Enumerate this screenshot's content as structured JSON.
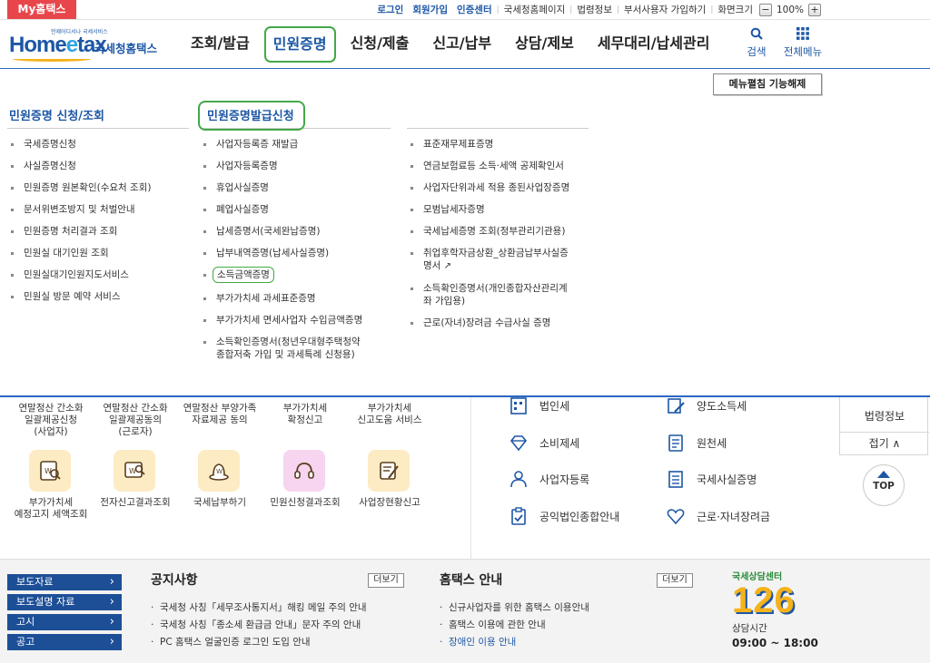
{
  "utility": {
    "my_tab": "My홈택스",
    "links": [
      "로그인",
      "회원가입",
      "인증센터",
      "국세청홈페이지",
      "법령정보",
      "부서사용자 가입하기",
      "화면크기"
    ],
    "zoom": "100%",
    "zoom_minus": "−",
    "zoom_plus": "+"
  },
  "header": {
    "logo_small": "언제어디서나 국세서비스",
    "logo_home": "Home",
    "logo_e": "e",
    "logo_tax": "tax",
    "logo_name": "국세청홈택스",
    "gnb": [
      "조회/발급",
      "민원증명",
      "신청/제출",
      "신고/납부",
      "상담/제보",
      "세무대리/납세관리"
    ],
    "search": "검색",
    "all_menu": "전체메뉴"
  },
  "mega": {
    "menu_off_button": "메뉴펼침 기능해제",
    "col1": {
      "heading": "민원증명 신청/조회",
      "items": [
        "국세증명신청",
        "사실증명신청",
        "민원증명 원본확인(수요처 조회)",
        "문서위변조방지 및 처벌안내",
        "민원증명 처리결과 조회",
        "민원실 대기인원 조회",
        "민원실대기인원지도서비스",
        "민원실 방문 예약 서비스"
      ]
    },
    "col2": {
      "heading": "민원증명발급신청",
      "items": [
        "사업자등록증 재발급",
        "사업자등록증명",
        "휴업사실증명",
        "폐업사실증명",
        "납세증명서(국세완납증명)",
        "납부내역증명(납세사실증명)",
        "소득금액증명",
        "부가가치세 과세표준증명",
        "부가가치세 면세사업자 수입금액증명"
      ],
      "item_last_line1": "소득확인증명서(청년우대형주택청약",
      "item_last_line2": "종합저축 가입 및 과세특례 신청용)"
    },
    "col3": {
      "items": [
        "표준재무제표증명",
        "연금보험료등 소득·세액 공제확인서",
        "사업자단위과세 적용 종된사업장증명",
        "모범납세자증명",
        "국세납세증명 조회(정부관리기관용)"
      ],
      "item6_line1": "취업후학자금상환_상환금납부사실증",
      "item6_line2": "명서",
      "item7_line1": "소득확인증명서(개인종합자산관리계",
      "item7_line2": "좌 가입용)",
      "item8": "근로(자녀)장려금 수급사실 증명"
    }
  },
  "main": {
    "quick_row1": [
      [
        "연말정산 간소화",
        "일괄제공신청",
        "(사업자)"
      ],
      [
        "연말정산 간소화",
        "일괄제공동의",
        "(근로자)"
      ],
      [
        "연말정산 부양가족",
        "자료제공 동의",
        ""
      ],
      [
        "부가가치세",
        "확정신고",
        ""
      ],
      [
        "부가가치세",
        "신고도움 서비스",
        ""
      ]
    ],
    "quick_row2": [
      [
        "부가가치세",
        "예정고지 세액조회"
      ],
      [
        "전자신고결과조회",
        ""
      ],
      [
        "국세납부하기",
        ""
      ],
      [
        "민원신청결과조회",
        ""
      ],
      [
        "사업장현황신고",
        ""
      ]
    ],
    "services": [
      "법인세",
      "양도소득세",
      "소비제세",
      "원천세",
      "사업자등록",
      "국세사실증명",
      "공익법인종합안내",
      "근로·자녀장려금"
    ],
    "side_title": "법령정보",
    "side_fold": "접기 ∧",
    "top": "TOP"
  },
  "footer": {
    "press": [
      "보도자료",
      "보도설명 자료",
      "고시",
      "공고"
    ],
    "notice_title": "공지사항",
    "notice_more": "더보기",
    "notices": [
      "국세청 사칭「세무조사통지서」해킹 메일 주의 안내",
      "국세청 사칭「종소세 환급금 안내」문자 주의 안내",
      "PC 홈택스 얼굴인증 로그인 도입 안내"
    ],
    "guide_title": "홈택스 안내",
    "guide_more": "더보기",
    "guides": [
      "신규사업자를 위한 홈택스 이용안내",
      "홈택스 이용에 관한 안내",
      "장애인 이용 안내"
    ],
    "callcenter_caption": "국세상담센터",
    "callcenter_number": "126",
    "callcenter_label": "상담시간",
    "callcenter_hours": "09:00 ~ 18:00"
  }
}
